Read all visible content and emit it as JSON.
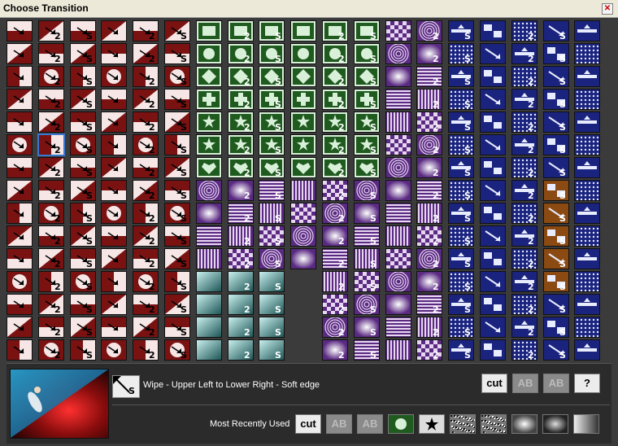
{
  "window": {
    "title": "Choose Transition",
    "close_label": "✕"
  },
  "colors": {
    "wipe": "#7a1212",
    "shape": "#1f5a1f",
    "shape_light": "#d8f0d8",
    "pattern": "#5a2a82",
    "special": "#1a237e",
    "brown": "#8a4a12",
    "teal": "#2e6f6f",
    "selected_outline": "#3a78d0"
  },
  "groups": [
    {
      "name": "wipes",
      "icon": "arrow-icon"
    },
    {
      "name": "shapes",
      "icon": "shape-icon"
    },
    {
      "name": "patterns",
      "icon": "pattern-icon"
    },
    {
      "name": "specials",
      "icon": "special-icon"
    }
  ],
  "selected": {
    "description": "Wipe - Upper Left to Lower Right - Soft edge",
    "badge": "S"
  },
  "tools": {
    "cut": "cut",
    "ab1": "AB",
    "ab2": "AB",
    "help": "?"
  },
  "mru": {
    "label": "Most Recently Used",
    "items": [
      "cut",
      "AB",
      "AB"
    ]
  },
  "badges": {
    "two": "2",
    "soft": "S"
  }
}
